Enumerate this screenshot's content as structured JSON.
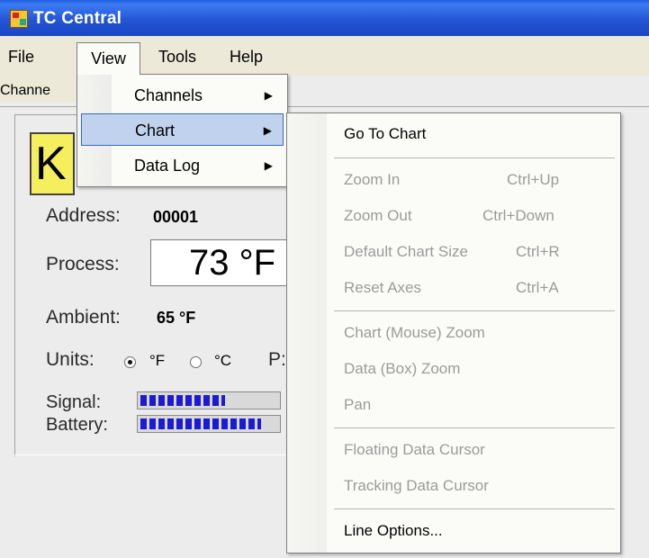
{
  "window": {
    "title": "TC Central"
  },
  "menubar": {
    "items": [
      {
        "label": "File"
      },
      {
        "label": "View"
      },
      {
        "label": "Tools"
      },
      {
        "label": "Help"
      }
    ]
  },
  "tab": {
    "label": "Channe"
  },
  "channel": {
    "type": "K",
    "address_label": "Address:",
    "address_value": "00001",
    "process_label": "Process:",
    "process_value": "73 °F",
    "ambient_label": "Ambient:",
    "ambient_value": "65 °F",
    "units_label": "Units:",
    "unit_f": "°F",
    "unit_c": "°C",
    "units_selected": "°F",
    "extra_label": "P:",
    "signal_label": "Signal:",
    "signal_level": 0.62,
    "battery_label": "Battery:",
    "battery_level": 0.88
  },
  "view_menu": {
    "items": [
      {
        "label": "Channels",
        "submenu": true
      },
      {
        "label": "Chart",
        "submenu": true,
        "highlighted": true
      },
      {
        "label": "Data Log",
        "submenu": true
      }
    ]
  },
  "chart_menu": {
    "go_to_chart": "Go To Chart",
    "zoom_in": "Zoom In",
    "zoom_in_shortcut": "Ctrl+Up",
    "zoom_out": "Zoom Out",
    "zoom_out_shortcut": "Ctrl+Down",
    "default_size": "Default Chart Size",
    "default_size_shortcut": "Ctrl+R",
    "reset_axes": "Reset Axes",
    "reset_axes_shortcut": "Ctrl+A",
    "mouse_zoom": "Chart (Mouse) Zoom",
    "box_zoom": "Data (Box) Zoom",
    "pan": "Pan",
    "floating_cursor": "Floating Data Cursor",
    "tracking_cursor": "Tracking Data Cursor",
    "line_options": "Line Options..."
  },
  "colors": {
    "titlebar": "#2455d6",
    "menu_highlight": "#c1d2ee",
    "type_box": "#f5ee5d",
    "bar_fill": "#1b1bd6"
  }
}
